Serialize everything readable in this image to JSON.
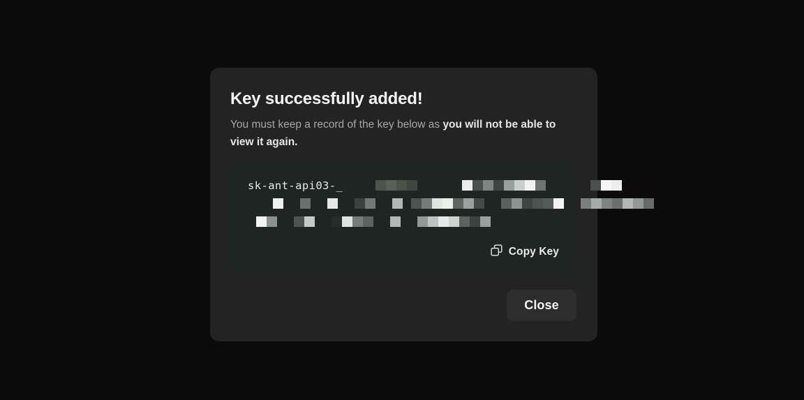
{
  "theme": {
    "page_background": "#0b0b0b",
    "modal_background": "#232323",
    "key_panel_background": "#1e2522",
    "button_background": "#2d2d2d",
    "text_primary": "#f4f4f4",
    "text_muted": "#a7a7a7"
  },
  "modal": {
    "title": "Key successfully added!",
    "description_lead": "You must keep a record of the key below as ",
    "description_strong": "you will not be able to view it again.",
    "key": {
      "visible_prefix": "sk-ant-api03-_",
      "redacted": true,
      "redaction_style": "pixelated",
      "lines": [
        {
          "groups": [
            {
              "gap_before": "gap-lg",
              "blocks": [
                "#4c534f",
                "#585f5b",
                "#4a514d",
                "#3e4541"
              ]
            },
            {
              "gap_before": "gap-xl",
              "blocks": [
                "#ececec",
                "#4a514d",
                "#7d8481",
                "#3e4541",
                "#9aa09d",
                "#c9cfcc",
                "#f2f2f2",
                "#6c7370"
              ]
            },
            {
              "gap_before": "gap-xl",
              "blocks": [
                "#4a514d",
                "#f7f7f7",
                "#ededed"
              ]
            }
          ]
        },
        {
          "groups": [
            {
              "gap_before": "gap-sm",
              "blocks": [
                "#f0f0f0"
              ]
            },
            {
              "gap_before": "gap-md",
              "blocks": [
                "#6a716d"
              ]
            },
            {
              "gap_before": "gap-md",
              "blocks": [
                "#e8e8e8"
              ]
            },
            {
              "gap_before": "gap-md",
              "blocks": [
                "#3b423e",
                "#717875"
              ]
            },
            {
              "gap_before": "gap-md",
              "blocks": [
                "#b2b8b5"
              ]
            },
            {
              "gap_before": "gap-sm",
              "blocks": [
                "#4d544f",
                "#767d79",
                "#dfe4e1",
                "#eceeea",
                "#5f6662",
                "#9ba19e",
                "#444b47"
              ]
            },
            {
              "gap_before": "gap-md",
              "blocks": [
                "#5a615d",
                "#8d938f",
                "#3f4642",
                "#4d544f",
                "#555c58",
                "#f4f4f4"
              ]
            },
            {
              "gap_before": "gap-md",
              "blocks": [
                "#7a817d",
                "#a5aba8",
                "#7d8481",
                "#6a716d",
                "#b0b6b3",
                "#919895",
                "#656c68"
              ]
            }
          ]
        },
        {
          "groups": [
            {
              "gap_before": "gap-sm",
              "blocks": [
                "#f3f3f3",
                "#8b918e"
              ]
            },
            {
              "gap_before": "gap-md",
              "blocks": [
                "#4d544f",
                "#c4cac7"
              ]
            },
            {
              "gap_before": "gap-md",
              "blocks": [
                "#262d29",
                "#dfe4e1",
                "#767d79",
                "#5c635f"
              ]
            },
            {
              "gap_before": "gap-md",
              "blocks": [
                "#b2b8b5"
              ]
            },
            {
              "gap_before": "gap-md",
              "blocks": [
                "#939a96",
                "#bdc3c0",
                "#e5eae7",
                "#cdd3d0",
                "#5c635f",
                "#3c433f",
                "#9aa09d"
              ]
            }
          ]
        }
      ]
    },
    "copy_button": {
      "label": "Copy Key",
      "icon": "copy-icon"
    },
    "close_button": {
      "label": "Close"
    }
  }
}
